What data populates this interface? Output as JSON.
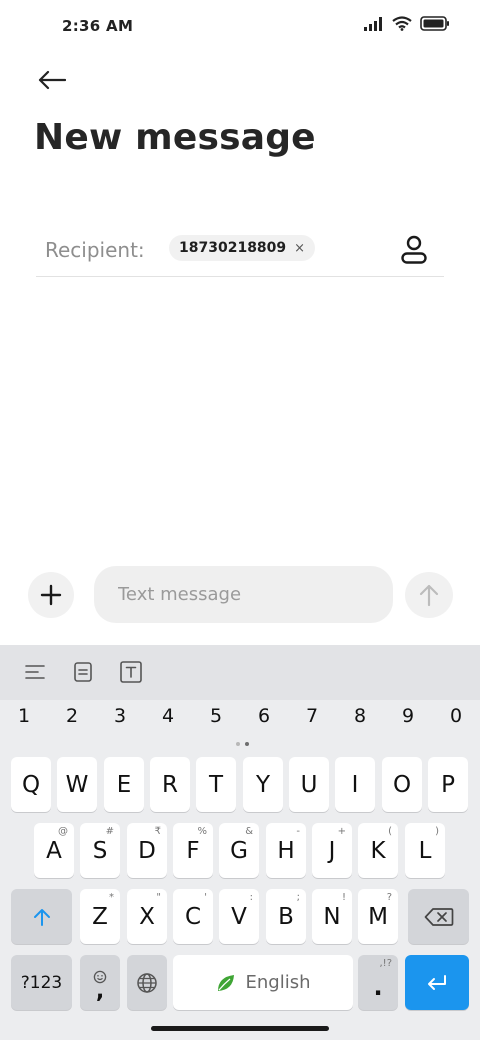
{
  "status_bar": {
    "time": "2:36 AM"
  },
  "header": {
    "title": "New message"
  },
  "recipient": {
    "label": "Recipient:",
    "chip_value": "18730218809",
    "chip_remove": "×"
  },
  "compose": {
    "placeholder": "Text message"
  },
  "keyboard": {
    "numbers": [
      "1",
      "2",
      "3",
      "4",
      "5",
      "6",
      "7",
      "8",
      "9",
      "0"
    ],
    "row1": [
      {
        "key": "Q"
      },
      {
        "key": "W"
      },
      {
        "key": "E"
      },
      {
        "key": "R"
      },
      {
        "key": "T"
      },
      {
        "key": "Y"
      },
      {
        "key": "U"
      },
      {
        "key": "I"
      },
      {
        "key": "O"
      },
      {
        "key": "P"
      }
    ],
    "row2": [
      {
        "key": "A",
        "hint": "@"
      },
      {
        "key": "S",
        "hint": "#"
      },
      {
        "key": "D",
        "hint": "₹"
      },
      {
        "key": "F",
        "hint": "%"
      },
      {
        "key": "G",
        "hint": "&"
      },
      {
        "key": "H",
        "hint": "-"
      },
      {
        "key": "J",
        "hint": "+"
      },
      {
        "key": "K",
        "hint": "("
      },
      {
        "key": "L",
        "hint": ")"
      }
    ],
    "row3": [
      {
        "key": "Z",
        "hint": "*"
      },
      {
        "key": "X",
        "hint": "\""
      },
      {
        "key": "C",
        "hint": "'"
      },
      {
        "key": "V",
        "hint": ":"
      },
      {
        "key": "B",
        "hint": ";"
      },
      {
        "key": "N",
        "hint": "!"
      },
      {
        "key": "M",
        "hint": "?"
      }
    ],
    "symbols_label": "?123",
    "comma": ",",
    "space_label": "English",
    "period": ".",
    "period_hint": ",!?"
  },
  "colors": {
    "accent": "#1b95ee",
    "keyboard_bg": "#ecedef",
    "key_bg": "#ffffff",
    "leaf": "#3fa535"
  }
}
